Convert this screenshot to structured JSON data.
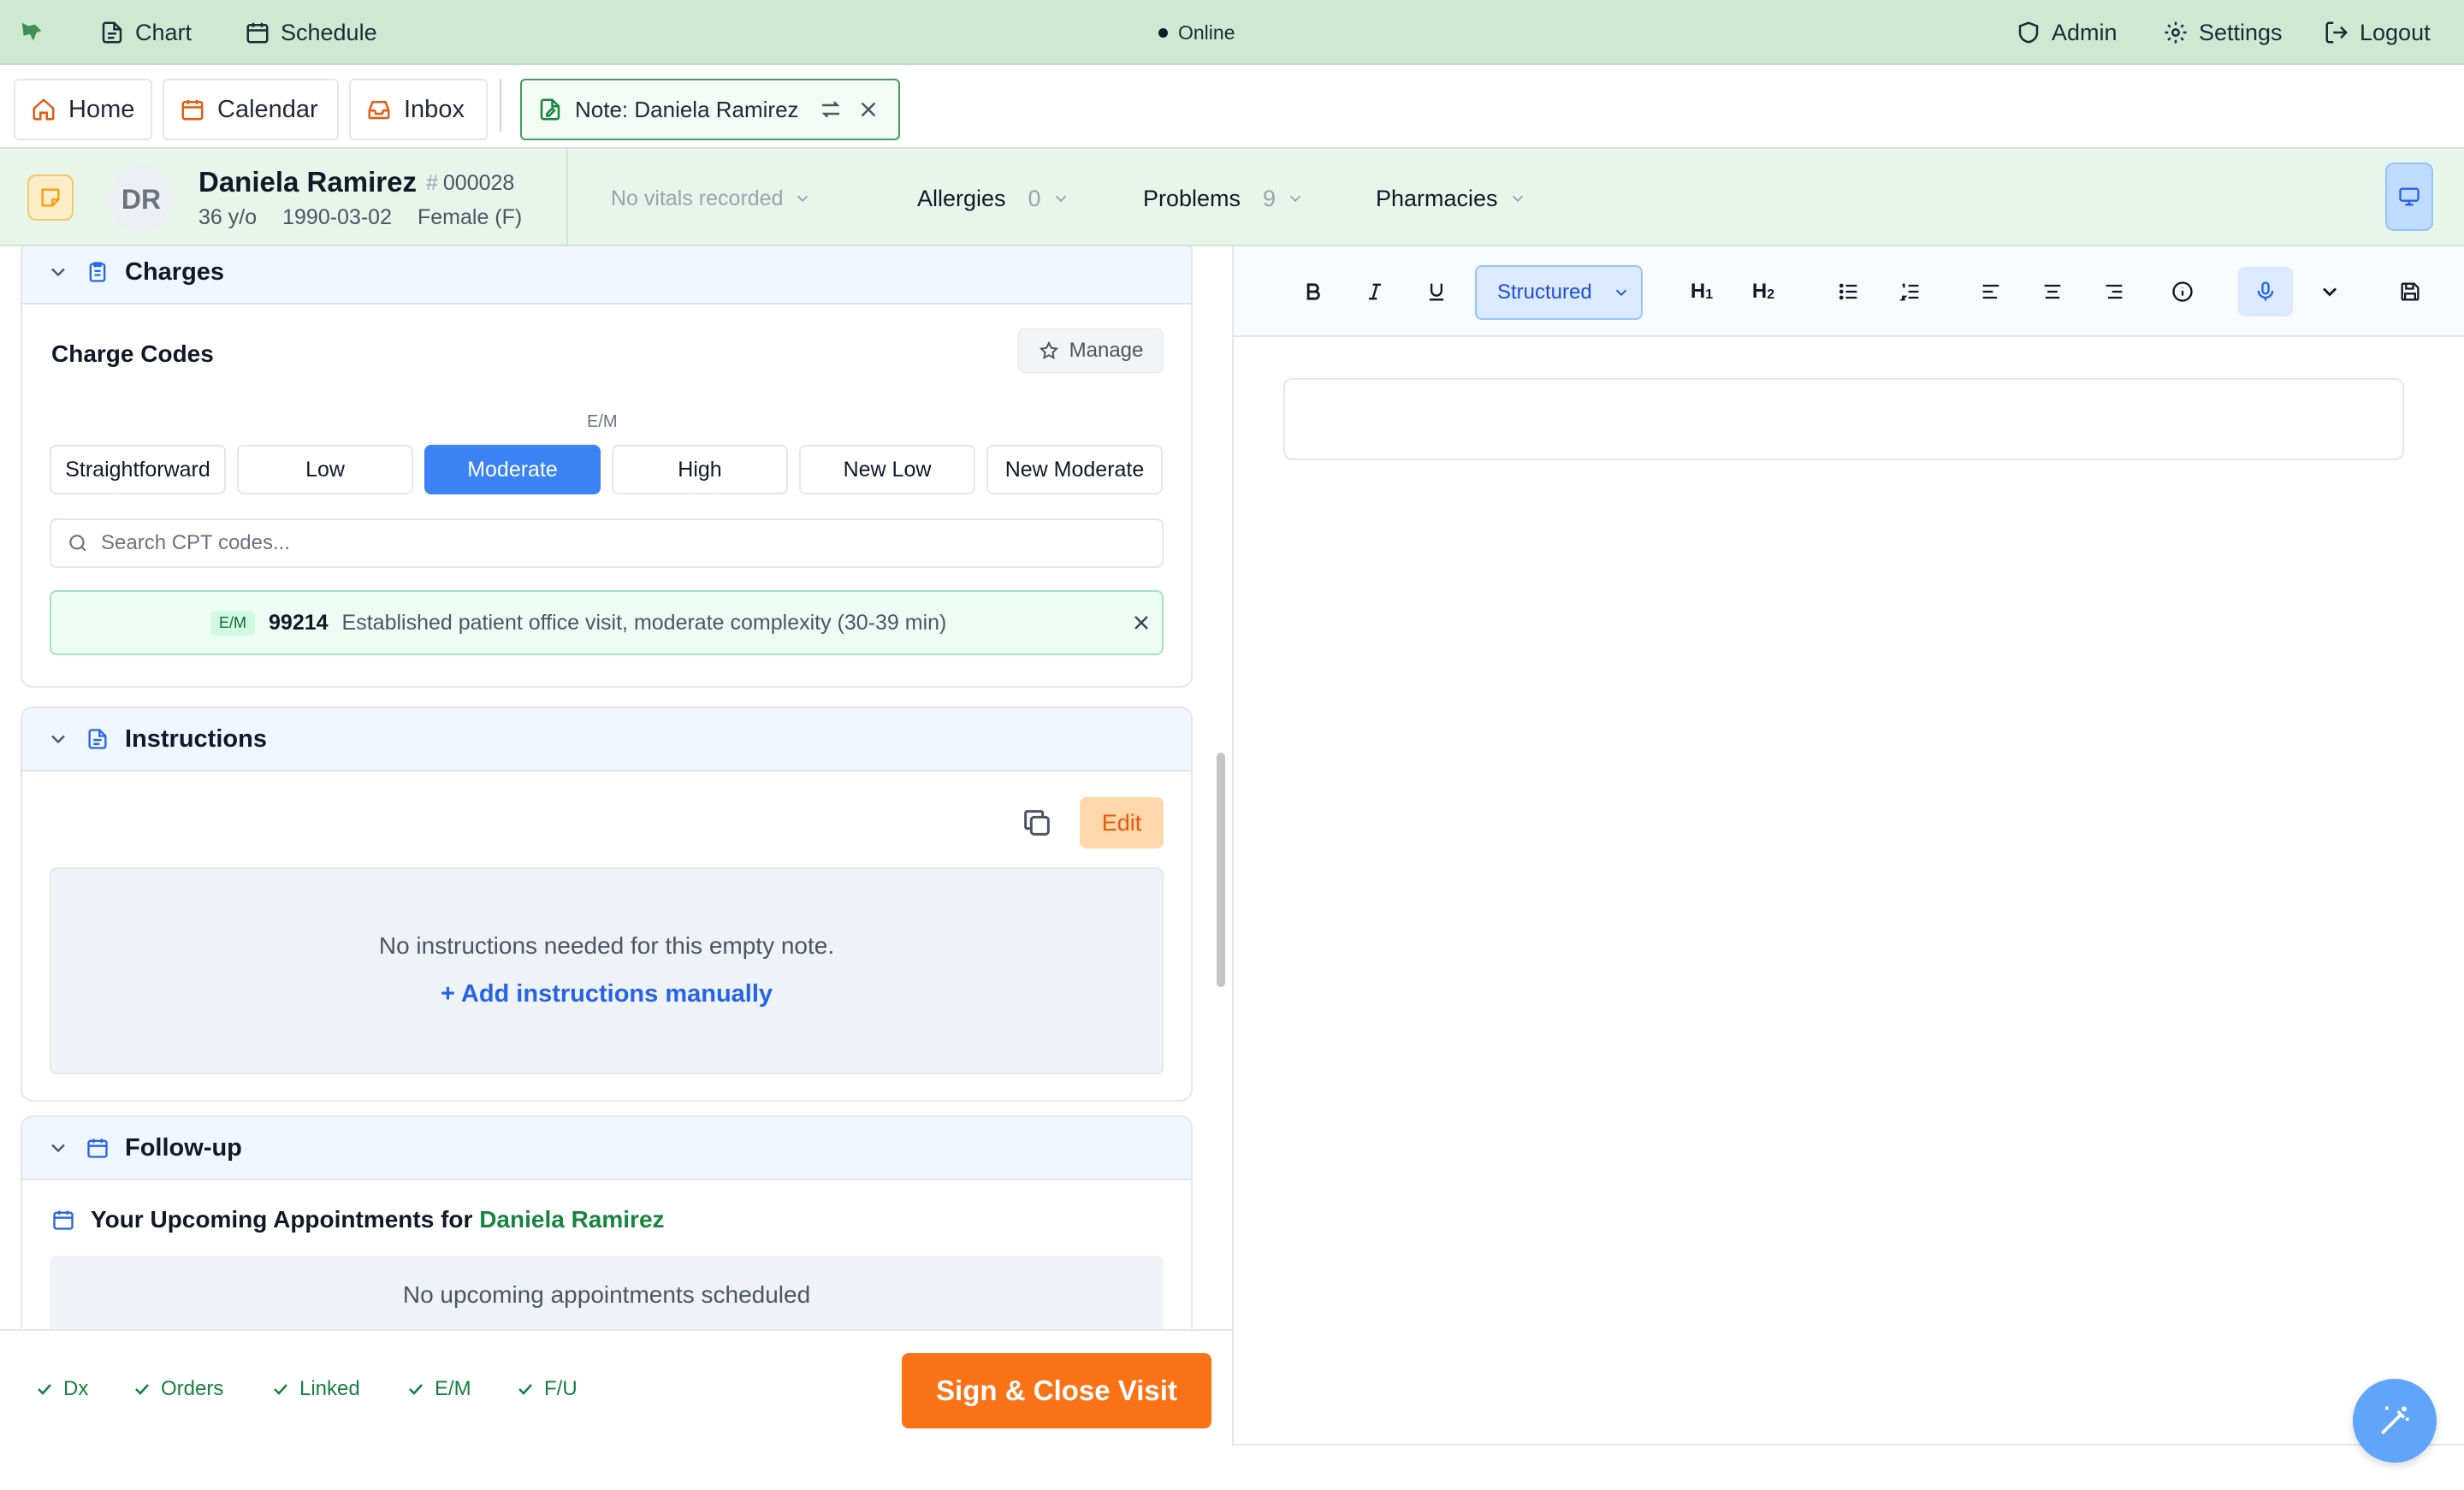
{
  "topbar": {
    "chart": "Chart",
    "schedule": "Schedule",
    "status": "Online",
    "admin": "Admin",
    "settings": "Settings",
    "logout": "Logout"
  },
  "tabs": {
    "home": "Home",
    "calendar": "Calendar",
    "inbox": "Inbox",
    "note": "Note: Daniela Ramirez"
  },
  "patient": {
    "initials": "DR",
    "name": "Daniela Ramirez",
    "mrn": "000028",
    "age": "36 y/o",
    "dob": "1990-03-02",
    "sex": "Female (F)",
    "vitals": "No vitals recorded",
    "allergies_label": "Allergies",
    "allergies_count": "0",
    "problems_label": "Problems",
    "problems_count": "9",
    "pharmacies_label": "Pharmacies"
  },
  "charges": {
    "header": "Charges",
    "title": "Charge Codes",
    "manage": "Manage",
    "em_label": "E/M",
    "levels": [
      "Straightforward",
      "Low",
      "Moderate",
      "High",
      "New Low",
      "New Moderate"
    ],
    "selected_level": "Moderate",
    "search_placeholder": "Search CPT codes...",
    "code_badge": "E/M",
    "code": "99214",
    "code_desc": "Established patient office visit, moderate complexity (30-39 min)"
  },
  "instructions": {
    "header": "Instructions",
    "edit": "Edit",
    "empty": "No instructions needed for this empty note.",
    "add": "+ Add instructions manually"
  },
  "followup": {
    "header": "Follow-up",
    "title_prefix": "Your Upcoming Appointments for",
    "patient_name": "Daniela Ramirez",
    "empty": "No upcoming appointments scheduled"
  },
  "checks": [
    "Dx",
    "Orders",
    "Linked",
    "E/M",
    "F/U"
  ],
  "sign_button": "Sign & Close Visit",
  "editor": {
    "mode": "Structured",
    "h1": "H",
    "h1_sub": "1",
    "h2": "H",
    "h2_sub": "2",
    "content": ""
  },
  "colors": {
    "topbar": "#cde9d2",
    "accent_blue": "#3b82f6",
    "accent_orange": "#f97316",
    "accent_green": "#16853f"
  }
}
